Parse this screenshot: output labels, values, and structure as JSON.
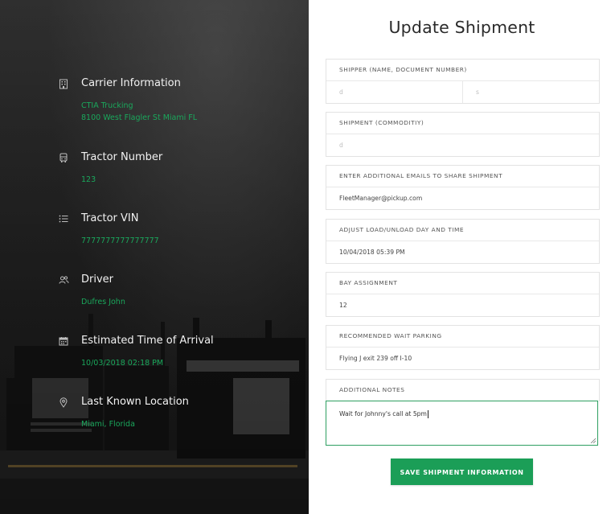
{
  "carrier": {
    "title": "Carrier Information",
    "name": "CTIA Trucking",
    "address": "8100 West Flagler St Miami FL",
    "icon": "building-icon"
  },
  "tractor_number": {
    "title": "Tractor Number",
    "value": "123",
    "icon": "truck-front-icon"
  },
  "tractor_vin": {
    "title": "Tractor VIN",
    "value": "7777777777777777",
    "icon": "list-icon"
  },
  "driver": {
    "title": "Driver",
    "value": "Dufres John",
    "icon": "users-icon"
  },
  "eta": {
    "title": "Estimated Time of Arrival",
    "value": "10/03/2018 02:18 PM",
    "icon": "calendar-icon"
  },
  "location": {
    "title": "Last Known Location",
    "value": "Miami, Florida",
    "icon": "map-pin-icon"
  },
  "form": {
    "title": "Update Shipment",
    "shipper": {
      "label": "SHIPPER (NAME, DOCUMENT NUMBER)",
      "name_value": "d",
      "doc_value": "s"
    },
    "commodity": {
      "label": "SHIPMENT (COMMODITIY)",
      "value": "d"
    },
    "emails": {
      "label": "ENTER ADDITIONAL EMAILS TO SHARE SHIPMENT",
      "value": "FleetManager@pickup.com"
    },
    "load": {
      "label": "ADJUST LOAD/UNLOAD DAY AND TIME",
      "value": "10/04/2018 05:39 PM"
    },
    "bay": {
      "label": "BAY ASSIGNMENT",
      "value": "12"
    },
    "parking": {
      "label": "RECOMMENDED WAIT PARKING",
      "value": "Flying J exit 239 off I-10"
    },
    "notes": {
      "label": "ADDITIONAL NOTES",
      "value": "Wait for Johnny's call at 5pm"
    },
    "save_label": "SAVE SHIPMENT INFORMATION"
  },
  "colors": {
    "accent": "#1b9e57",
    "panel": "#232323",
    "green_text": "#1aa85c"
  }
}
